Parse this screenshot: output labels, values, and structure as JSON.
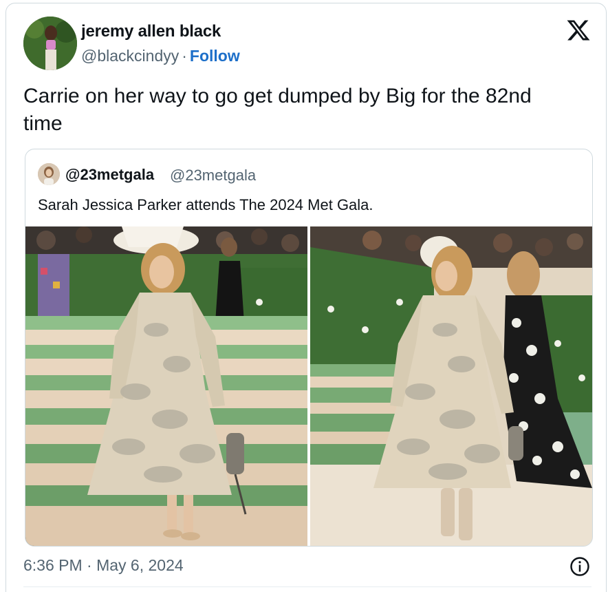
{
  "author": {
    "display_name": "jeremy allen black",
    "handle": "@blackcindyy",
    "separator": "·",
    "follow_label": "Follow"
  },
  "tweet": {
    "text": "Carrie on her way to go get dumped by Big for the 82nd time",
    "timestamp": "6:36 PM · May 6, 2024"
  },
  "quoted": {
    "display_name": "@23metgala",
    "handle": "@23metgala",
    "text": "Sarah Jessica Parker attends The 2024 Met Gala."
  },
  "icons": {
    "platform": "x-logo-icon",
    "info": "info-icon"
  },
  "colors": {
    "follow": "#1d6fc9",
    "secondary_text": "#536471",
    "border": "#cfd9de"
  }
}
